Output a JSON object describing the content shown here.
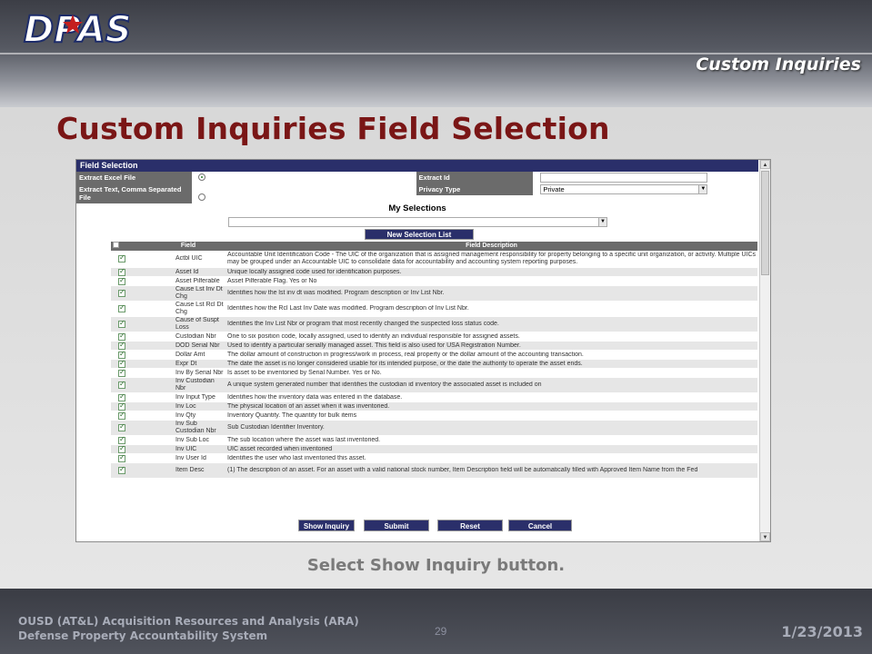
{
  "slide": {
    "logo_text": "DPAS",
    "section_label": "Custom Inquiries",
    "title": "Custom Inquiries Field Selection",
    "caption": "Select Show Inquiry button.",
    "footer_line1": "OUSD (AT&L) Acquisition Resources and Analysis (ARA)",
    "footer_line2": "Defense Property Accountability System",
    "page_number": "29",
    "date": "1/23/2013"
  },
  "panel": {
    "title": "Field Selection",
    "extract_excel_label": "Extract Excel File",
    "extract_excel_selected": true,
    "extract_text_label": "Extract Text, Comma Separated File",
    "extract_text_selected": false,
    "extract_id_label": "Extract Id",
    "extract_id_value": "",
    "privacy_type_label": "Privacy Type",
    "privacy_type_value": "Private",
    "my_selections_label": "My Selections",
    "my_selections_value": "",
    "new_selection_button": "New Selection List"
  },
  "table": {
    "headers": {
      "select": "Select/Deselect",
      "field": "Field",
      "description": "Field Description"
    },
    "rows": [
      {
        "field": "Actbl UIC",
        "description": "Accountable Unit Identification Code - The UIC of the organization that is assigned management responsibility for property belonging to a specific unit organization, or activity. Multiple UICs may be grouped under an Accountable UIC to consolidate data for accountability and accounting system reporting purposes.",
        "checked": true
      },
      {
        "field": "Asset Id",
        "description": "Unique locally assigned code used for identification purposes.",
        "checked": true
      },
      {
        "field": "Asset Pilferable",
        "description": "Asset Pilferable Flag. Yes or No",
        "checked": true
      },
      {
        "field": "Cause Lst Inv Dt Chg",
        "description": "Identifies how the lst inv dt was modified. Program description or Inv List Nbr.",
        "checked": true
      },
      {
        "field": "Cause Lst Rcl Dt Chg",
        "description": "Identifies how the Rcl Last Inv Date was modified. Program description of Inv List Nbr.",
        "checked": true
      },
      {
        "field": "Cause of Suspt Loss",
        "description": "Identifies the Inv List Nbr or program that most recently changed the suspected loss status code.",
        "checked": true
      },
      {
        "field": "Custodian Nbr",
        "description": "One to six position code, locally assigned, used to identify an individual responsible for assigned assets.",
        "checked": true
      },
      {
        "field": "DOD Serial Nbr",
        "description": "Used to identify a particular serially managed asset. This field is also used for USA Registration Number.",
        "checked": true
      },
      {
        "field": "Dollar Amt",
        "description": "The dollar amount of construction in progress/work in process, real property or the dollar amount of the accounting transaction.",
        "checked": true
      },
      {
        "field": "Expr Dt",
        "description": "The date the asset is no longer considered usable for its intended purpose, or the date the authority to operate the asset ends.",
        "checked": true
      },
      {
        "field": "Inv By Serial Nbr",
        "description": "Is asset to be inventoried by Serial Number. Yes or No.",
        "checked": true
      },
      {
        "field": "Inv Custodian Nbr",
        "description": "A unique system generated number that identifies the custodian id inventory the associated asset is included on",
        "checked": true
      },
      {
        "field": "Inv Input Type",
        "description": "Identifies how the inventory data was entered in the database.",
        "checked": true
      },
      {
        "field": "Inv Loc",
        "description": "The physical location of an asset when it was inventoried.",
        "checked": true
      },
      {
        "field": "Inv Qty",
        "description": "Inventory Quantity. The quantity for bulk items",
        "checked": true
      },
      {
        "field": "Inv Sub Custodian Nbr",
        "description": "Sub Custodian Identifier Inventory.",
        "checked": true
      },
      {
        "field": "Inv Sub Loc",
        "description": "The sub location where the asset was last inventoried.",
        "checked": true
      },
      {
        "field": "Inv UIC",
        "description": "UIC asset recorded when inventoried",
        "checked": true
      },
      {
        "field": "Inv User Id",
        "description": "Identifies the user who last inventoried this asset.",
        "checked": true
      },
      {
        "field": "Item Desc",
        "description": "(1) The description of an asset. For an asset with a valid national stock number, Item Description field will be automatically filled with Approved Item Name from the Fed",
        "checked": true
      }
    ]
  },
  "buttons": {
    "show_inquiry": "Show Inquiry",
    "submit": "Submit",
    "reset": "Reset",
    "cancel": "Cancel"
  },
  "colors": {
    "title": "#7a1616",
    "panel_header": "#2a2f6a",
    "label_bg": "#6b6b6b"
  }
}
